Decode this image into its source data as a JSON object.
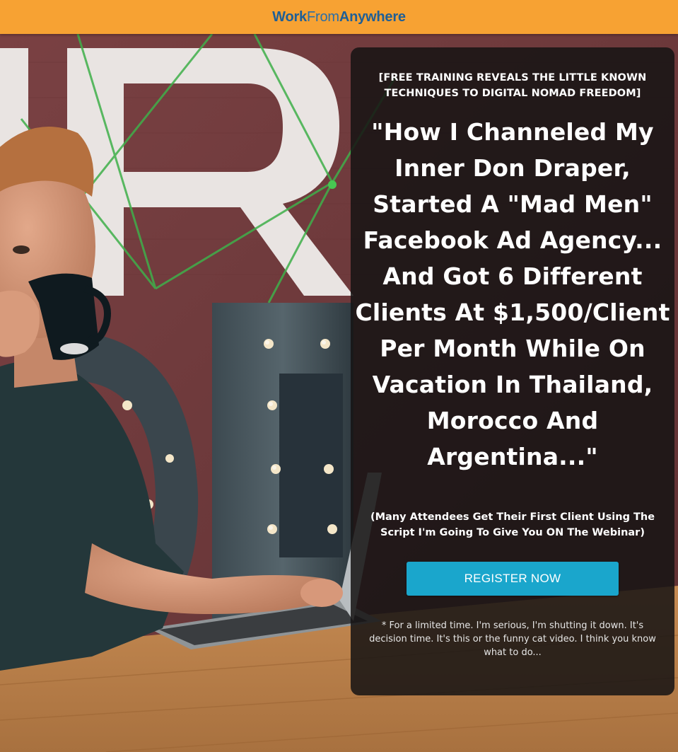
{
  "header": {
    "logo_part1": "Work",
    "logo_part2": "From",
    "logo_part3": "Anywhere"
  },
  "hero": {
    "kicker": "[FREE TRAINING REVEALS THE LITTLE KNOWN TECHNIQUES TO DIGITAL NOMAD FREEDOM]",
    "headline": "\"How I Channeled My Inner Don Draper, Started A \"Mad Men\" Facebook Ad Agency... And Got 6 Different Clients At $1,500/Client Per Month While On Vacation In Thailand, Morocco And Argentina...\"",
    "subnote": "(Many Attendees Get Their First Client Using The Script I'm Going To Give You ON The Webinar)",
    "cta_label": "REGISTER NOW",
    "disclaimer": "* For a limited time. I'm serious, I'm shutting it down. It's decision time. It's this or the funny cat video. I think you know what to do..."
  },
  "colors": {
    "topbar": "#f7a233",
    "logo_blue": "#1f5f96",
    "cta": "#1aa6cc",
    "panel": "#161414"
  }
}
